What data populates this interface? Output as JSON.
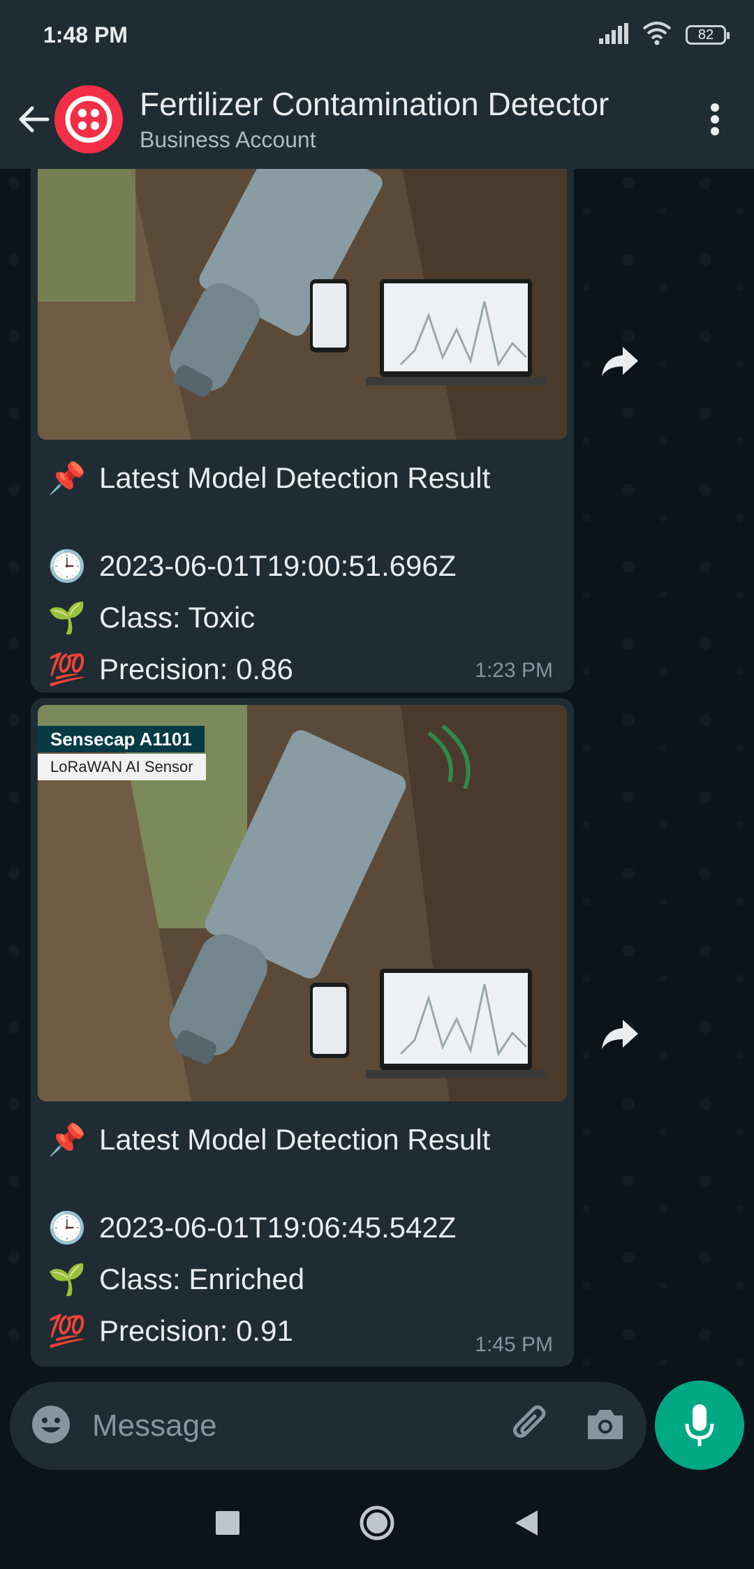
{
  "status_bar": {
    "time": "1:48 PM",
    "battery": "82"
  },
  "header": {
    "title": "Fertilizer Contamination Detector",
    "subtitle": "Business Account"
  },
  "messages": [
    {
      "heading": "Latest Model Detection Result",
      "timestamp_line": "2023-06-01T19:00:51.696Z",
      "class_line": "Class: Toxic",
      "precision_line": "Precision: 0.86",
      "time": "1:23 PM"
    },
    {
      "image_label_1": "Sensecap A1101",
      "image_label_2": "LoRaWAN AI Sensor",
      "heading": "Latest Model Detection Result",
      "timestamp_line": "2023-06-01T19:06:45.542Z",
      "class_line": "Class: Enriched",
      "precision_line": "Precision: 0.91",
      "time": "1:45 PM"
    }
  ],
  "composer": {
    "placeholder": "Message"
  },
  "icons": {
    "pin": "pushpin-icon",
    "clock": "clock-icon",
    "seedling": "seedling-icon",
    "hundred": "hundred-points-icon"
  }
}
